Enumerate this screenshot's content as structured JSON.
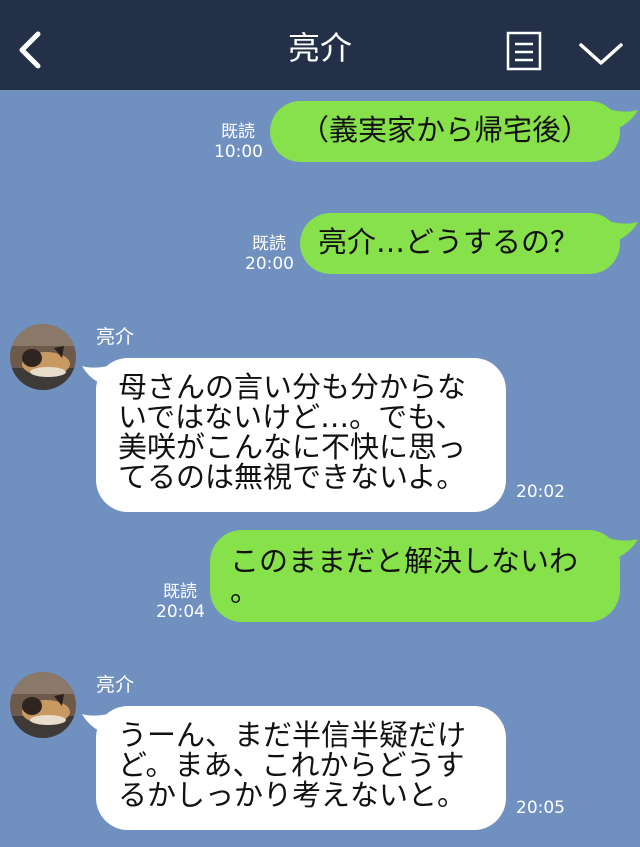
{
  "header": {
    "title": "亮介"
  },
  "messages": [
    {
      "side": "right",
      "read": "既読",
      "time": "10:00",
      "text": "（義実家から帰宅後）"
    },
    {
      "side": "right",
      "read": "既読",
      "time": "20:00",
      "text": "亮介…どうするの？"
    },
    {
      "side": "left",
      "sender": "亮介",
      "time": "20:02",
      "lines": [
        "母さんの言い分も分からな",
        "いではないけど…。でも、",
        "美咲がこんなに不快に思っ",
        "てるのは無視できないよ。"
      ]
    },
    {
      "side": "right",
      "read": "既読",
      "time": "20:04",
      "lines": [
        "このままだと解決しないわ",
        "。"
      ]
    },
    {
      "side": "left",
      "sender": "亮介",
      "time": "20:05",
      "lines": [
        "うーん、まだ半信半疑だけ",
        "ど。まあ、これからどうす",
        "るかしっかり考えないと。"
      ]
    }
  ],
  "icons": {
    "back": "back-chevron-icon",
    "notes": "notes-icon",
    "menu": "chevron-down-icon"
  },
  "colors": {
    "background": "#7090c0",
    "header": "#243048",
    "sent_bubble": "#86e14a",
    "received_bubble": "#ffffff"
  }
}
